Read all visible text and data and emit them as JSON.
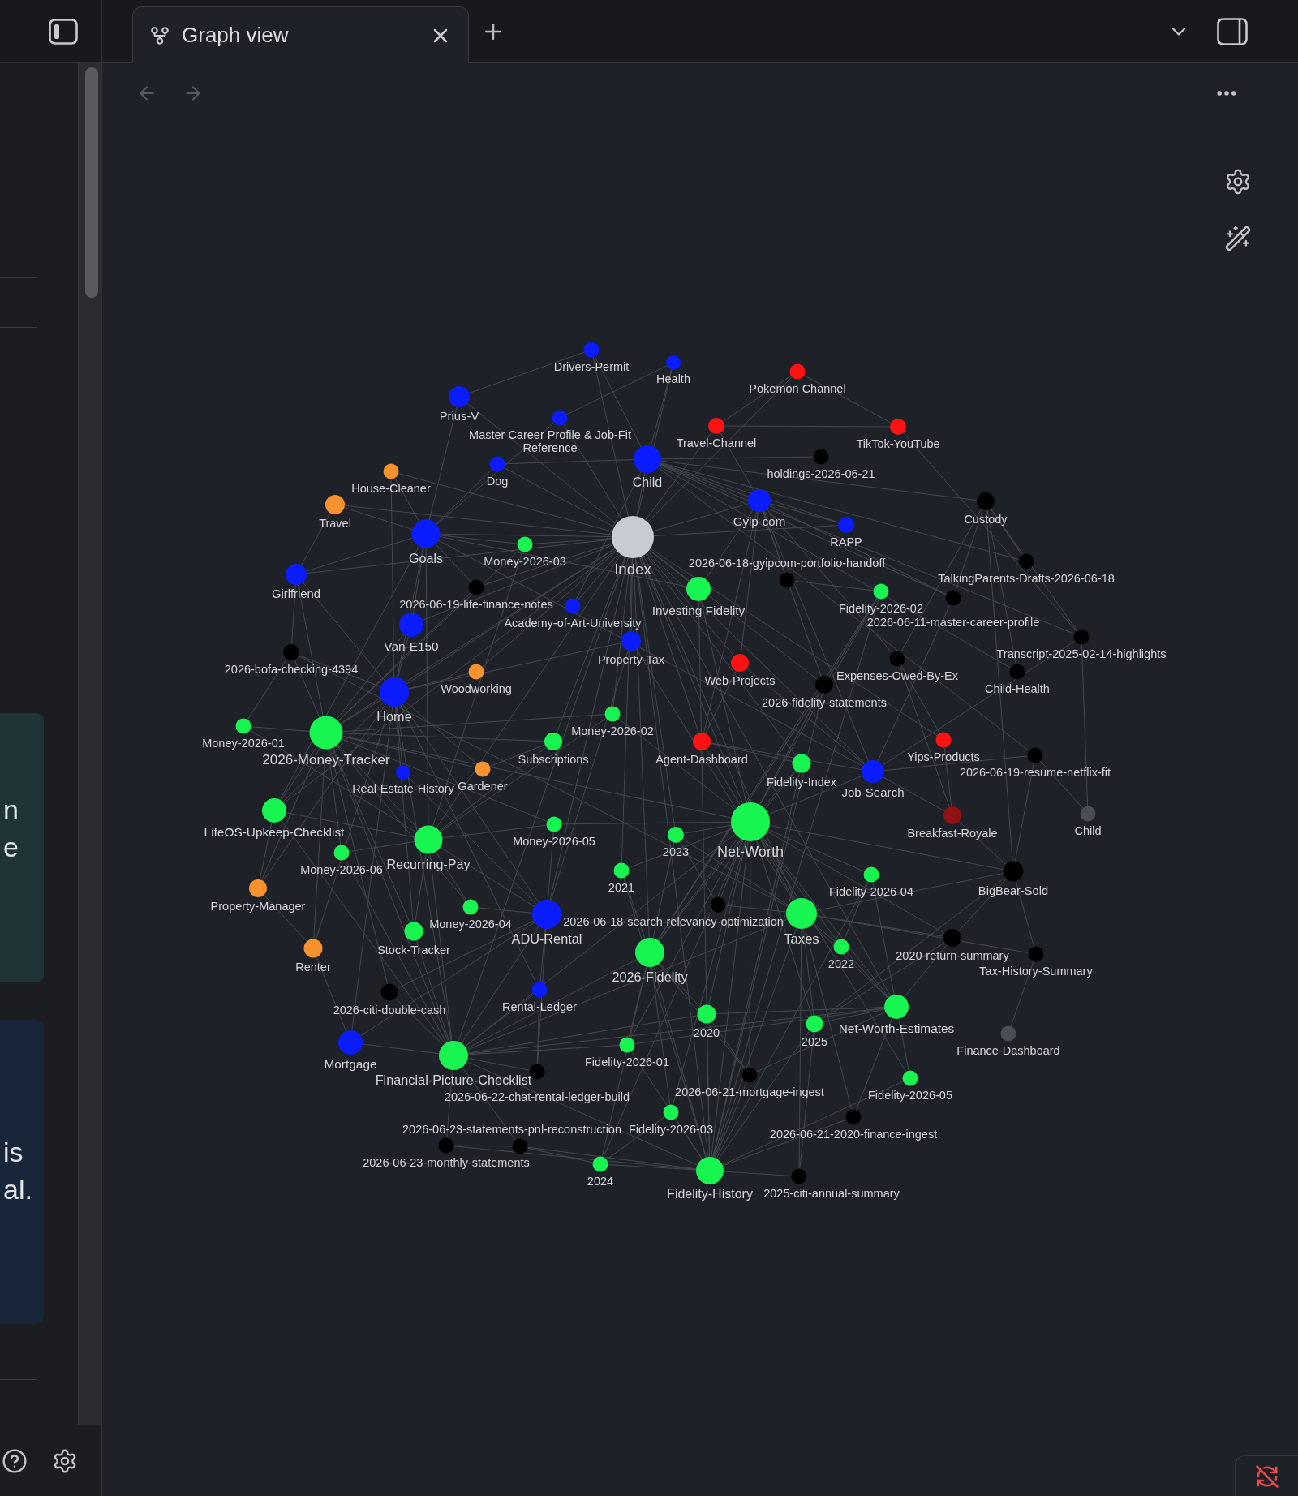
{
  "left_sidebar": {
    "cards": [
      {
        "color": "#1f3437",
        "lines": [
          "n",
          "e"
        ]
      },
      {
        "color": "#18263a",
        "lines": [
          "is",
          "al."
        ]
      }
    ]
  },
  "tabs": [
    {
      "title": "Graph view",
      "selected": true
    }
  ],
  "navigation": {
    "back": {
      "disabled": true
    },
    "forward": {
      "disabled": true
    }
  },
  "graph": {
    "nodes": [
      {
        "label": "Drivers-Permit",
        "color": "#0b1cff"
      },
      {
        "label": "Health",
        "color": "#0b1cff"
      },
      {
        "label": "Pokemon Channel",
        "color": "#ff1212"
      },
      {
        "label": "Prius-V",
        "color": "#0b1cff"
      },
      {
        "label": "Master Career Profile & Job-Fit Reference",
        "color": "#0b1cff"
      },
      {
        "label": "Travel-Channel",
        "color": "#ff1212"
      },
      {
        "label": "TikTok-YouTube",
        "color": "#ff1212"
      },
      {
        "label": "Dog",
        "color": "#0b1cff"
      },
      {
        "label": "Child",
        "color": "#0b1cff"
      },
      {
        "label": "holdings-2026-06-21",
        "color": "#000000"
      },
      {
        "label": "House-Cleaner",
        "color": "#f7922e"
      },
      {
        "label": "Travel",
        "color": "#f7922e"
      },
      {
        "label": "Gyip-com",
        "color": "#0b1cff"
      },
      {
        "label": "Custody",
        "color": "#000000"
      },
      {
        "label": "RAPP",
        "color": "#0b1cff"
      },
      {
        "label": "Goals",
        "color": "#0b1cff"
      },
      {
        "label": "Money-2026-03",
        "color": "#19f550"
      },
      {
        "label": "Index",
        "color": "#c8ccd2"
      },
      {
        "label": "2026-06-18-gyipcom-portfolio-handoff",
        "color": "#000000"
      },
      {
        "label": "TalkingParents-Drafts-2026-06-18",
        "color": "#000000"
      },
      {
        "label": "Girlfriend",
        "color": "#0b1cff"
      },
      {
        "label": "2026-06-19-life-finance-notes",
        "color": "#000000"
      },
      {
        "label": "Investing Fidelity",
        "color": "#19f550"
      },
      {
        "label": "Fidelity-2026-02",
        "color": "#19f550"
      },
      {
        "label": "Academy-of-Art-University",
        "color": "#0b1cff"
      },
      {
        "label": "2026-06-11-master-career-profile",
        "color": "#000000"
      },
      {
        "label": "Van-E150",
        "color": "#0b1cff"
      },
      {
        "label": "Property-Tax",
        "color": "#0b1cff"
      },
      {
        "label": "Transcript-2025-02-14-highlights",
        "color": "#000000"
      },
      {
        "label": "2026-bofa-checking-4394",
        "color": "#000000"
      },
      {
        "label": "Web-Projects",
        "color": "#ff1212"
      },
      {
        "label": "Expenses-Owed-By-Ex",
        "color": "#000000"
      },
      {
        "label": "Woodworking",
        "color": "#f7922e"
      },
      {
        "label": "Child-Health",
        "color": "#000000"
      },
      {
        "label": "2026-fidelity-statements",
        "color": "#000000"
      },
      {
        "label": "Home",
        "color": "#0b1cff"
      },
      {
        "label": "Money-2026-02",
        "color": "#19f550"
      },
      {
        "label": "Money-2026-01",
        "color": "#19f550"
      },
      {
        "label": "2026-Money-Tracker",
        "color": "#19f550"
      },
      {
        "label": "Subscriptions",
        "color": "#19f550"
      },
      {
        "label": "Agent-Dashboard",
        "color": "#ff1212"
      },
      {
        "label": "Yips-Products",
        "color": "#ff1212"
      },
      {
        "label": "2026-06-19-resume-netflix-fit",
        "color": "#000000"
      },
      {
        "label": "Real-Estate-History",
        "color": "#0b1cff"
      },
      {
        "label": "Gardener",
        "color": "#f7922e"
      },
      {
        "label": "Fidelity-Index",
        "color": "#19f550"
      },
      {
        "label": "Job-Search",
        "color": "#0b1cff"
      },
      {
        "label": "LifeOS-Upkeep-Checklist",
        "color": "#19f550"
      },
      {
        "label": "Breakfast-Royale",
        "color": "#8e1212"
      },
      {
        "label": "Child",
        "color": "#4a4d52"
      },
      {
        "label": "Money-2026-05",
        "color": "#19f550"
      },
      {
        "label": "2023",
        "color": "#19f550"
      },
      {
        "label": "Net-Worth",
        "color": "#19f550"
      },
      {
        "label": "Money-2026-06",
        "color": "#19f550"
      },
      {
        "label": "Recurring-Pay",
        "color": "#19f550"
      },
      {
        "label": "2021",
        "color": "#19f550"
      },
      {
        "label": "Fidelity-2026-04",
        "color": "#19f550"
      },
      {
        "label": "BigBear-Sold",
        "color": "#000000"
      },
      {
        "label": "Property-Manager",
        "color": "#f7922e"
      },
      {
        "label": "Money-2026-04",
        "color": "#19f550"
      },
      {
        "label": "2026-06-18-search-relevancy-optimization",
        "color": "#000000"
      },
      {
        "label": "ADU-Rental",
        "color": "#0b1cff"
      },
      {
        "label": "Taxes",
        "color": "#19f550"
      },
      {
        "label": "Stock-Tracker",
        "color": "#19f550"
      },
      {
        "label": "2020-return-summary",
        "color": "#000000"
      },
      {
        "label": "Renter",
        "color": "#f7922e"
      },
      {
        "label": "2026-Fidelity",
        "color": "#19f550"
      },
      {
        "label": "2022",
        "color": "#19f550"
      },
      {
        "label": "Tax-History-Summary",
        "color": "#000000"
      },
      {
        "label": "2026-citi-double-cash",
        "color": "#000000"
      },
      {
        "label": "Rental-Ledger",
        "color": "#0b1cff"
      },
      {
        "label": "2020",
        "color": "#19f550"
      },
      {
        "label": "Net-Worth-Estimates",
        "color": "#19f550"
      },
      {
        "label": "2025",
        "color": "#19f550"
      },
      {
        "label": "Finance-Dashboard",
        "color": "#4a4d52"
      },
      {
        "label": "Mortgage",
        "color": "#0b1cff"
      },
      {
        "label": "Fidelity-2026-01",
        "color": "#19f550"
      },
      {
        "label": "Financial-Picture-Checklist",
        "color": "#19f550"
      },
      {
        "label": "2026-06-22-chat-rental-ledger-build",
        "color": "#000000"
      },
      {
        "label": "2026-06-21-mortgage-ingest",
        "color": "#000000"
      },
      {
        "label": "Fidelity-2026-05",
        "color": "#19f550"
      },
      {
        "label": "2026-06-23-monthly-statements",
        "color": "#000000"
      },
      {
        "label": "2026-06-23-statements-pnl-reconstruction",
        "color": "#000000"
      },
      {
        "label": "Fidelity-2026-03",
        "color": "#19f550"
      },
      {
        "label": "2026-06-21-2020-finance-ingest",
        "color": "#000000"
      },
      {
        "label": "2024",
        "color": "#19f550"
      },
      {
        "label": "Fidelity-History",
        "color": "#19f550"
      },
      {
        "label": "2025-citi-annual-summary",
        "color": "#000000"
      }
    ]
  },
  "status_bar": {
    "sync_on": false
  }
}
